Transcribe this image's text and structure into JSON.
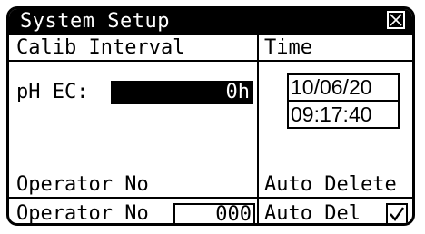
{
  "window": {
    "title": "System Setup",
    "close_icon": "close-x-icon"
  },
  "calib": {
    "header": "Calib Interval",
    "ph_ec_label": "pH EC:",
    "ph_ec_value": "0h"
  },
  "time": {
    "header": "Time",
    "date": "10/06/20",
    "clock": "09:17:40"
  },
  "operator": {
    "header": "Operator No",
    "field_label": "Operator No",
    "value": "000"
  },
  "auto_delete": {
    "header": "Auto Delete",
    "field_label": "Auto Del",
    "checked": true,
    "check_icon": "checkmark-icon"
  }
}
